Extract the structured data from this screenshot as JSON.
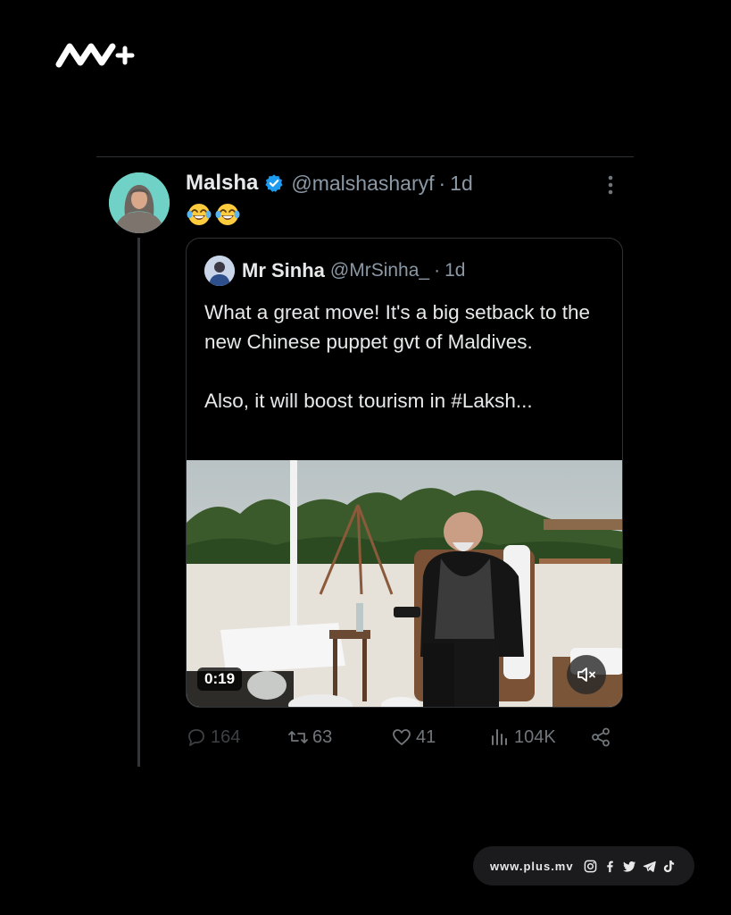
{
  "brand": {
    "logo_icon": "mv-plus-logo",
    "accent": "#ffffff"
  },
  "tweet": {
    "author_name": "Malsha",
    "handle": "@malshasharyf",
    "separator": "·",
    "time": "1d",
    "verified_color": "#1d9bf0",
    "emojis": [
      "face-with-tears-of-joy",
      "face-with-tears-of-joy"
    ],
    "more_icon": "more-vertical-icon"
  },
  "quote": {
    "author_name": "Mr Sinha",
    "handle": "@MrSinha_",
    "separator": "·",
    "time": "1d",
    "text": "What a great move! It's a big setback to the new Chinese puppet gvt of Maldives.\n\nAlso, it will boost tourism in #Laksh...",
    "video_duration": "0:19",
    "mute_icon": "speaker-muted-icon"
  },
  "actions": {
    "replies": "164",
    "retweets": "63",
    "likes": "41",
    "views": "104K",
    "share_icon": "share-icon"
  },
  "footer": {
    "url": "www.plus.mv",
    "social_icons": [
      "instagram-icon",
      "facebook-icon",
      "twitter-icon",
      "telegram-icon",
      "tiktok-icon"
    ]
  }
}
